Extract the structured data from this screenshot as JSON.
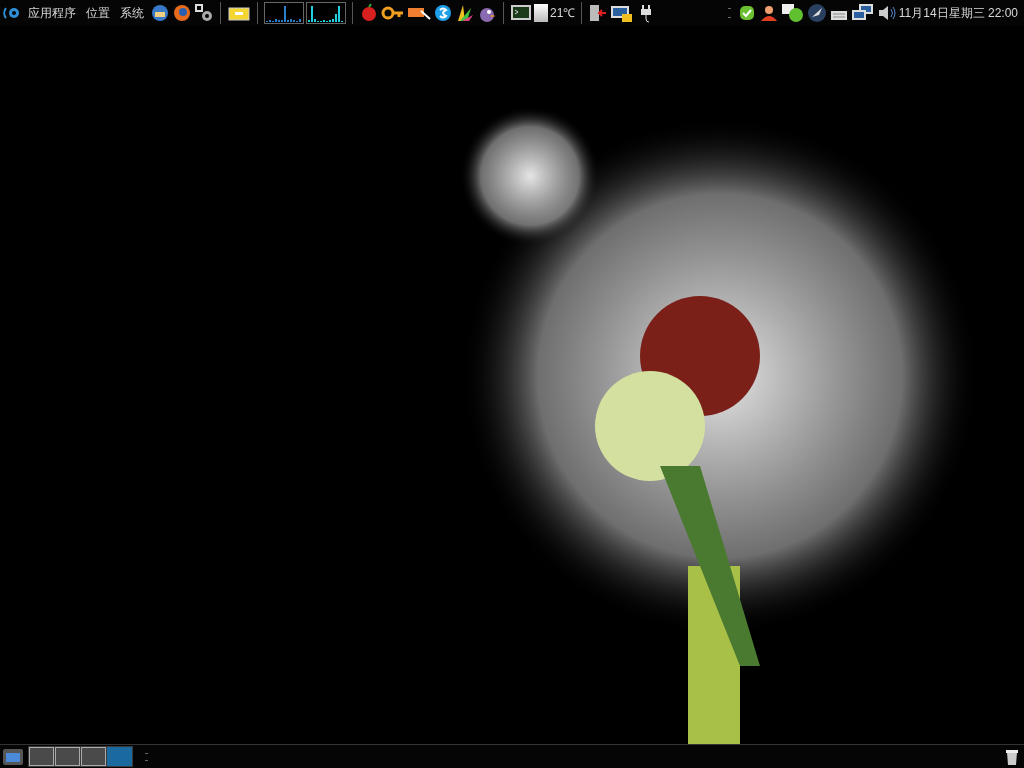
{
  "top_panel": {
    "menus": [
      {
        "label": "应用程序"
      },
      {
        "label": "位置"
      },
      {
        "label": "系统"
      }
    ],
    "temperature": "21℃",
    "clock": "11月14日星期三 22:00"
  },
  "bottom_panel": {
    "workspaces": [
      {
        "selected": false
      },
      {
        "selected": false
      },
      {
        "selected": false
      },
      {
        "selected": true
      }
    ]
  }
}
